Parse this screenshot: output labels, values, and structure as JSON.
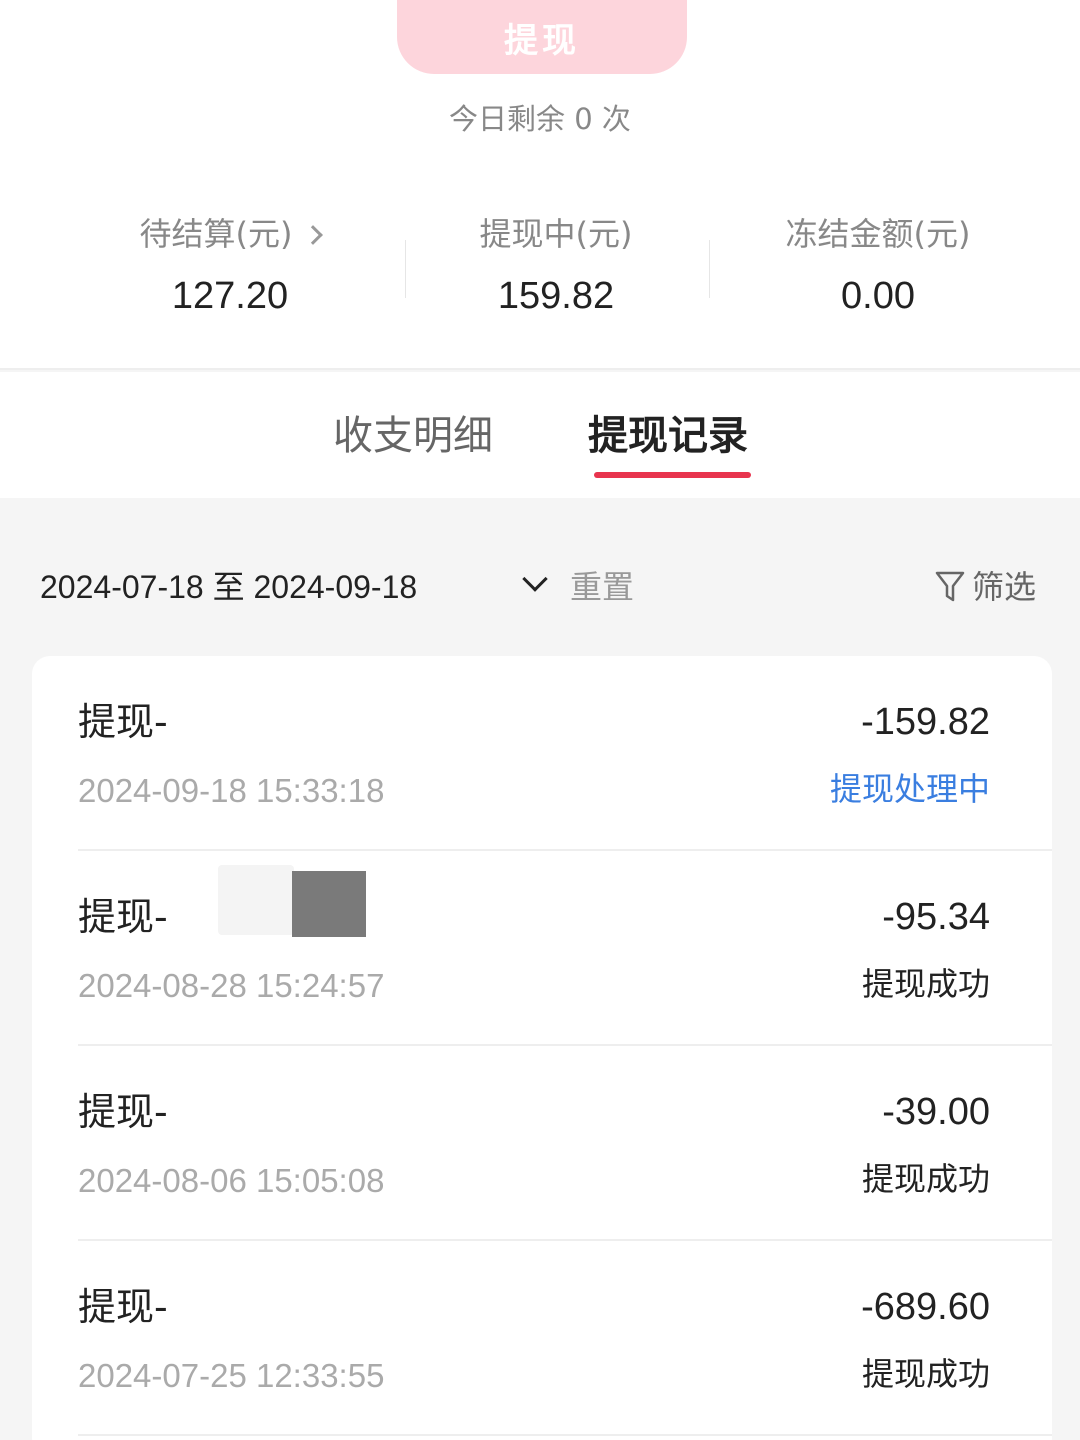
{
  "header": {
    "withdraw_button": "提现",
    "remaining_text": "今日剩余 0 次"
  },
  "stats": [
    {
      "label": "待结算(元)",
      "value": "127.20",
      "has_arrow": true
    },
    {
      "label": "提现中(元)",
      "value": "159.82",
      "has_arrow": false
    },
    {
      "label": "冻结金额(元)",
      "value": "0.00",
      "has_arrow": false
    }
  ],
  "tabs": [
    {
      "label": "收支明细",
      "active": false
    },
    {
      "label": "提现记录",
      "active": true
    }
  ],
  "filter": {
    "date_range": "2024-07-18 至 2024-09-18",
    "reset_label": "重置",
    "filter_label": "筛选"
  },
  "records": [
    {
      "title": "提现-",
      "time": "2024-09-18 15:33:18",
      "amount": "-159.82",
      "status": "提现处理中",
      "status_color": "#3a7ee0"
    },
    {
      "title": "提现-",
      "time": "2024-08-28 15:24:57",
      "amount": "-95.34",
      "status": "提现成功",
      "status_color": "#222222"
    },
    {
      "title": "提现-",
      "time": "2024-08-06 15:05:08",
      "amount": "-39.00",
      "status": "提现成功",
      "status_color": "#222222"
    },
    {
      "title": "提现-",
      "time": "2024-07-25 12:33:55",
      "amount": "-689.60",
      "status": "提现成功",
      "status_color": "#222222"
    }
  ],
  "colors": {
    "accent": "#e8344e",
    "button_disabled": "#fdd5dc",
    "processing": "#3a7ee0"
  }
}
